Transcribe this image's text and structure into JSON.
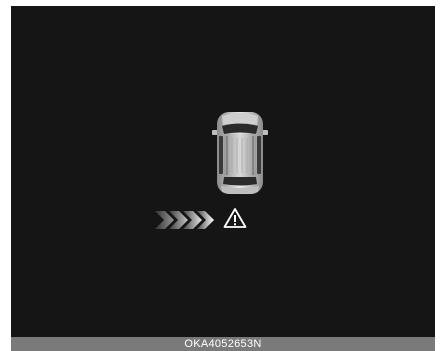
{
  "display": {
    "vehicle_icon": "car-top-view-icon",
    "approach_icon": "triple-chevron-right-icon",
    "alert_icon": "warning-triangle-icon"
  },
  "caption": {
    "code": "OKA4052653N"
  },
  "colors": {
    "screen_background": "#151515",
    "caption_bar": "#7a7a7a",
    "icon_white": "#ffffff"
  }
}
